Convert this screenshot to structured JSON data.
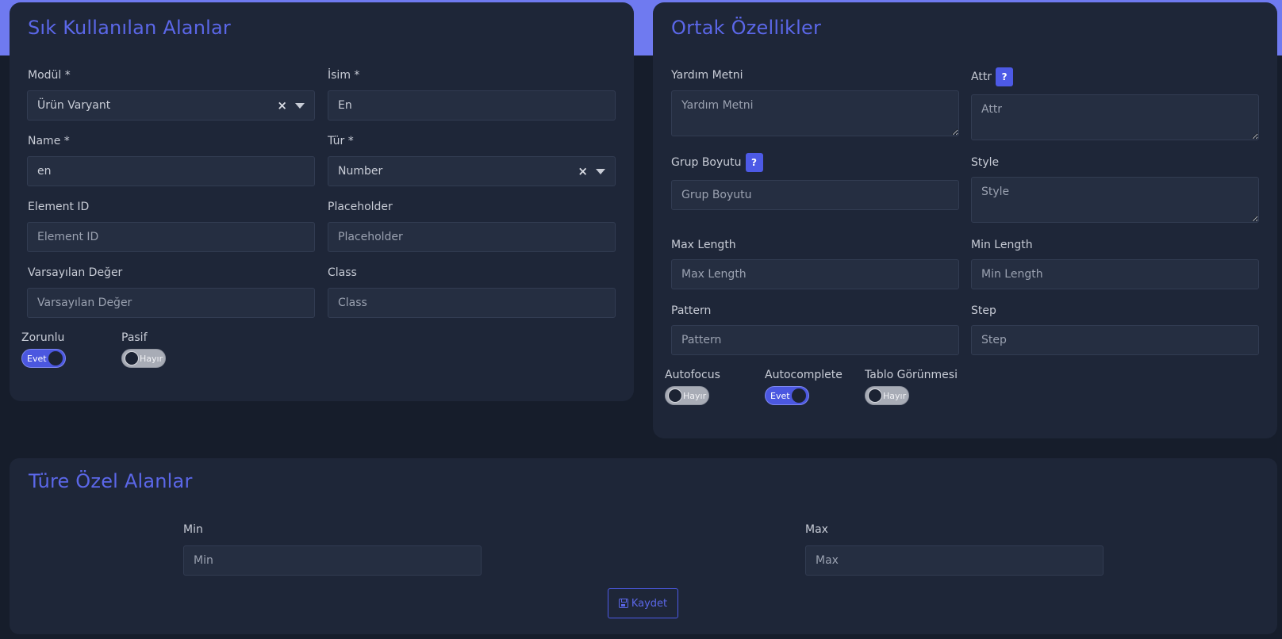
{
  "colors": {
    "accent": "#5b67e8",
    "top_band": "#6f7af0",
    "background": "#161d2b",
    "card": "#1e2638"
  },
  "common_fields": {
    "title": "Sık Kullanılan Alanlar",
    "modul": {
      "label": "Modül *",
      "value": "Ürün Varyant"
    },
    "isim": {
      "label": "İsim *",
      "value": "En"
    },
    "name": {
      "label": "Name *",
      "value": "en"
    },
    "tur": {
      "label": "Tür *",
      "value": "Number"
    },
    "element_id": {
      "label": "Element ID",
      "placeholder": "Element ID"
    },
    "placeholder": {
      "label": "Placeholder",
      "placeholder": "Placeholder"
    },
    "default_value": {
      "label": "Varsayılan Değer",
      "placeholder": "Varsayılan Değer"
    },
    "class": {
      "label": "Class",
      "placeholder": "Class"
    },
    "required": {
      "label": "Zorunlu",
      "state": "Evet"
    },
    "passive": {
      "label": "Pasif",
      "state": "Hayır"
    }
  },
  "shared_props": {
    "title": "Ortak Özellikler",
    "help_text": {
      "label": "Yardım Metni",
      "placeholder": "Yardım Metni"
    },
    "attr": {
      "label": "Attr",
      "badge": "?",
      "placeholder": "Attr"
    },
    "group_size": {
      "label": "Grup Boyutu",
      "badge": "?",
      "placeholder": "Grup Boyutu"
    },
    "style": {
      "label": "Style",
      "placeholder": "Style"
    },
    "max_length": {
      "label": "Max Length",
      "placeholder": "Max Length"
    },
    "min_length": {
      "label": "Min Length",
      "placeholder": "Min Length"
    },
    "pattern": {
      "label": "Pattern",
      "placeholder": "Pattern"
    },
    "step": {
      "label": "Step",
      "placeholder": "Step"
    },
    "autofocus": {
      "label": "Autofocus",
      "state": "Hayır"
    },
    "autocomplete": {
      "label": "Autocomplete",
      "state": "Evet"
    },
    "table_view": {
      "label": "Tablo Görünmesi",
      "state": "Hayır"
    }
  },
  "type_specific": {
    "title": "Türe Özel Alanlar",
    "min": {
      "label": "Min",
      "placeholder": "Min"
    },
    "max": {
      "label": "Max",
      "placeholder": "Max"
    },
    "save_label": "Kaydet"
  }
}
